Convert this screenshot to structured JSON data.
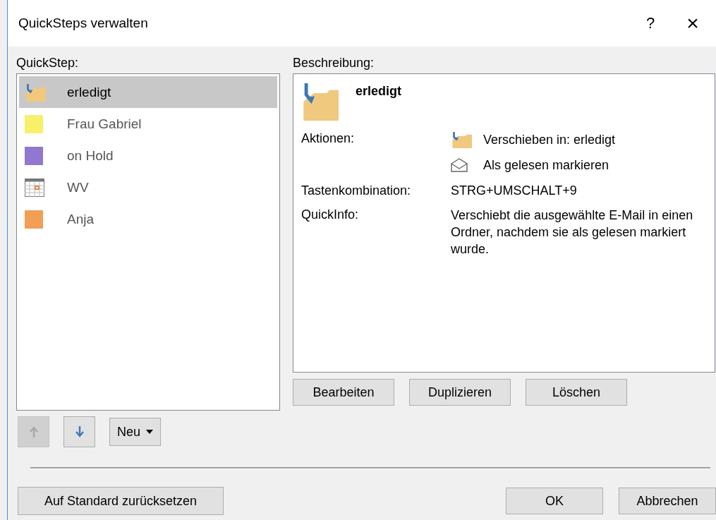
{
  "window": {
    "title": "QuickSteps verwalten",
    "help": "?",
    "close": "×"
  },
  "quicksteps": {
    "label": "QuickStep:",
    "items": [
      {
        "kind": "folder",
        "name": "erledigt",
        "selected": true
      },
      {
        "kind": "color",
        "name": "Frau Gabriel",
        "color": "#f9f06a",
        "selected": false
      },
      {
        "kind": "color",
        "name": "on Hold",
        "color": "#9177cf",
        "selected": false
      },
      {
        "kind": "calendar",
        "name": "WV",
        "selected": false
      },
      {
        "kind": "color",
        "name": "Anja",
        "color": "#f29f55",
        "selected": false
      }
    ]
  },
  "move_buttons": [
    {
      "kind": "up",
      "disabled": true
    },
    {
      "kind": "down",
      "disabled": false
    }
  ],
  "new_button": {
    "label": "Neu"
  },
  "description": {
    "label": "Beschreibung:",
    "title": "erledigt",
    "actions_label": "Aktionen:",
    "actions": [
      {
        "kind": "folder",
        "text": "Verschieben in: erledigt"
      },
      {
        "kind": "envelope",
        "text": "Als gelesen markieren"
      }
    ],
    "shortcut_label": "Tastenkombination:",
    "shortcut": "STRG+UMSCHALT+9",
    "tooltip_label": "QuickInfo:",
    "tooltip": "Verschiebt die ausgewählte E-Mail in einen Ordner, nachdem sie als gelesen markiert wurde."
  },
  "edit_buttons": [
    "Bearbeiten",
    "Duplizieren",
    "Löschen"
  ],
  "reset_button": "Auf Standard zurücksetzen",
  "dialog_buttons": [
    "OK",
    "Abbrechen"
  ]
}
